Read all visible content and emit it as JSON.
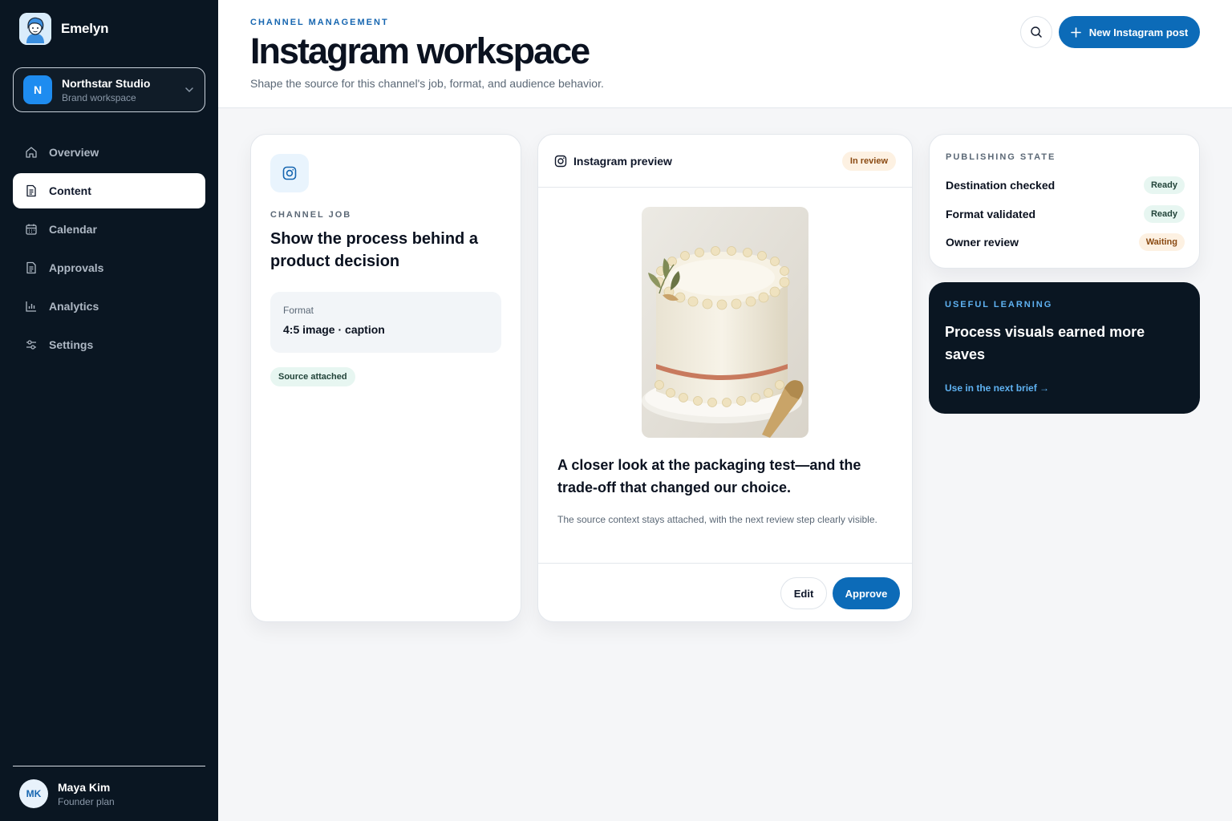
{
  "app": {
    "name": "Emelyn"
  },
  "workspace": {
    "initial": "N",
    "name": "Northstar Studio",
    "subtitle": "Brand workspace"
  },
  "nav": [
    {
      "label": "Overview",
      "icon": "home-icon",
      "active": false
    },
    {
      "label": "Content",
      "icon": "document-icon",
      "active": true
    },
    {
      "label": "Calendar",
      "icon": "calendar-icon",
      "active": false
    },
    {
      "label": "Approvals",
      "icon": "document-check-icon",
      "active": false
    },
    {
      "label": "Analytics",
      "icon": "bar-chart-icon",
      "active": false
    },
    {
      "label": "Settings",
      "icon": "sliders-icon",
      "active": false
    }
  ],
  "user": {
    "initials": "MK",
    "name": "Maya Kim",
    "plan": "Founder plan"
  },
  "header": {
    "eyebrow": "CHANNEL MANAGEMENT",
    "title": "Instagram workspace",
    "subtitle": "Shape the source for this channel's job, format, and audience behavior.",
    "primary_action": "New Instagram post"
  },
  "job": {
    "label": "CHANNEL JOB",
    "title": "Show the process behind a product decision",
    "format_label": "Format",
    "format_value": "4:5 image · caption",
    "source_badge": "Source attached"
  },
  "preview": {
    "title": "Instagram preview",
    "status": "In review",
    "caption": "A closer look at the packaging test—and the trade-off that changed our choice.",
    "note": "The source context stays attached, with the next review step clearly visible.",
    "edit_label": "Edit",
    "approve_label": "Approve"
  },
  "publishing": {
    "title": "PUBLISHING STATE",
    "rows": [
      {
        "label": "Destination checked",
        "status": "Ready"
      },
      {
        "label": "Format validated",
        "status": "Ready"
      },
      {
        "label": "Owner review",
        "status": "Waiting"
      }
    ]
  },
  "learning": {
    "eyebrow": "USEFUL LEARNING",
    "title": "Process visuals earned more saves",
    "link": "Use in the next brief →"
  },
  "colors": {
    "accent": "#0c6bb8",
    "sidebar": "#0a1622",
    "ready_bg": "#e7f6f1",
    "waiting_bg": "#fdf1e2"
  }
}
